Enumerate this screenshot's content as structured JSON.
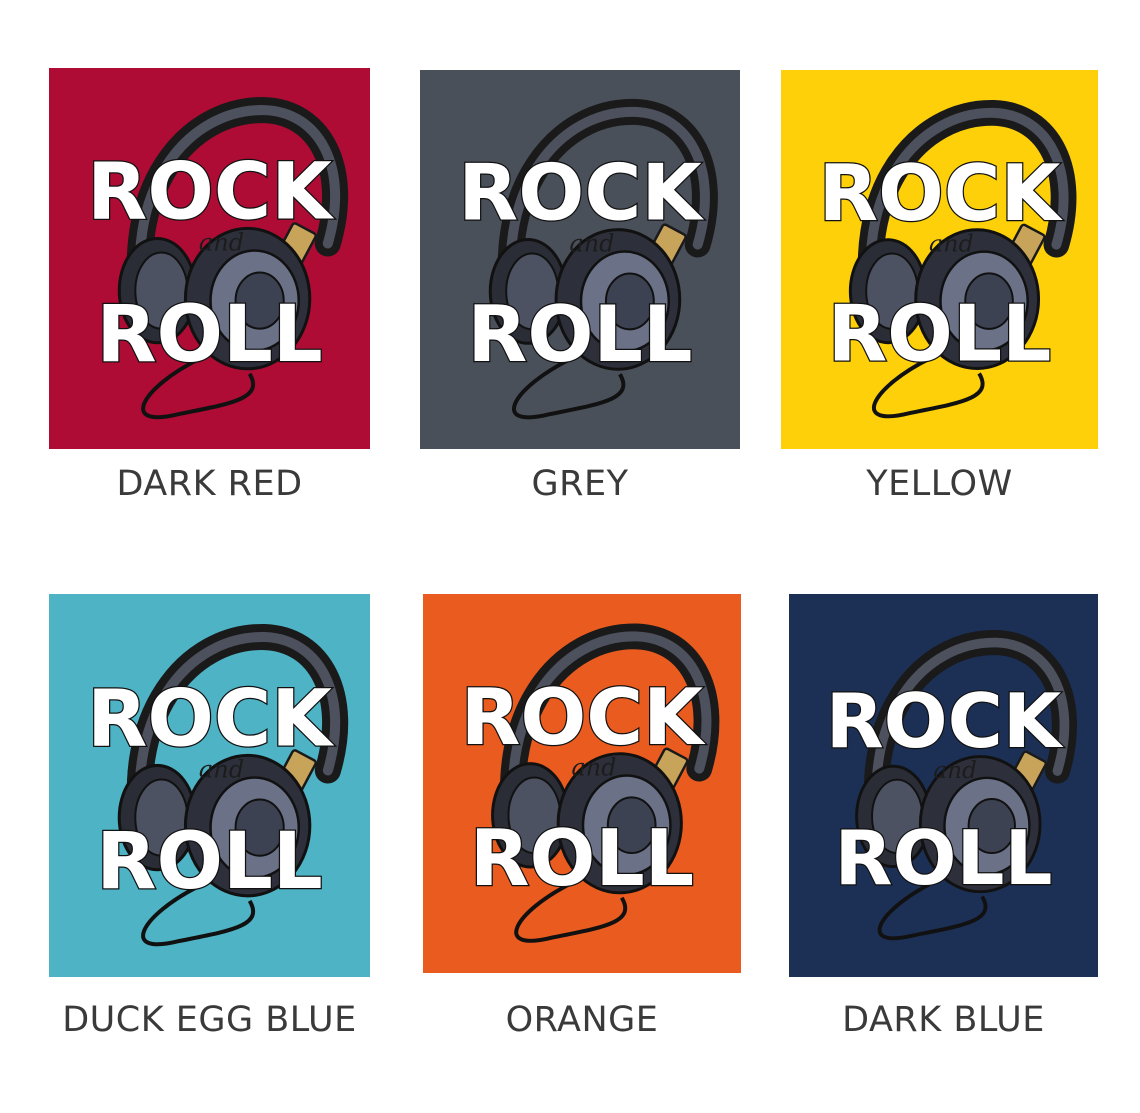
{
  "design": {
    "word_top": "ROCK",
    "word_mid": "and",
    "word_bottom": "ROLL"
  },
  "swatches": [
    {
      "name": "DARK RED",
      "color": "#AE0C34"
    },
    {
      "name": "GREY",
      "color": "#4A505A"
    },
    {
      "name": "YELLOW",
      "color": "#FDD009"
    },
    {
      "name": "DUCK EGG BLUE",
      "color": "#4DB3C5"
    },
    {
      "name": "ORANGE",
      "color": "#EA5B1F"
    },
    {
      "name": "DARK BLUE",
      "color": "#1C2F55"
    }
  ],
  "icons": {
    "graphic": "headphones-icon"
  }
}
